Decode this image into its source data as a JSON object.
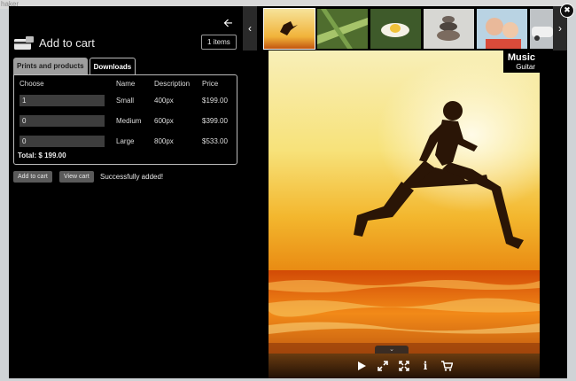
{
  "background": {
    "top_text": "haker"
  },
  "cart": {
    "title": "Add to cart",
    "items_count": "1 items",
    "tabs": [
      {
        "label": "Prints and products",
        "active": false
      },
      {
        "label": "Downloads",
        "active": true
      }
    ],
    "columns": [
      "Choose",
      "Name",
      "Description",
      "Price"
    ],
    "rows": [
      {
        "qty": "1",
        "name": "Small",
        "description": "400px",
        "price": "$199.00"
      },
      {
        "qty": "0",
        "name": "Medium",
        "description": "600px",
        "price": "$399.00"
      },
      {
        "qty": "0",
        "name": "Large",
        "description": "800px",
        "price": "$533.00"
      }
    ],
    "total": "Total: $ 199.00",
    "add_button": "Add to cart",
    "view_button": "View cart",
    "status": "Successfully added!"
  },
  "photo": {
    "title": "Music",
    "subtitle": "Guitar"
  },
  "icons": {
    "back": "arrow-left-icon",
    "close": "close-icon",
    "prev": "chevron-left-icon",
    "next": "chevron-right-icon",
    "play": "play-icon",
    "expand": "expand-icon",
    "fullscreen": "fullscreen-icon",
    "info": "info-icon",
    "cart": "cart-icon"
  },
  "colors": {
    "overlay": "#000000",
    "button": "#5a5a5a",
    "tab_inactive": "#9e9e9e"
  }
}
